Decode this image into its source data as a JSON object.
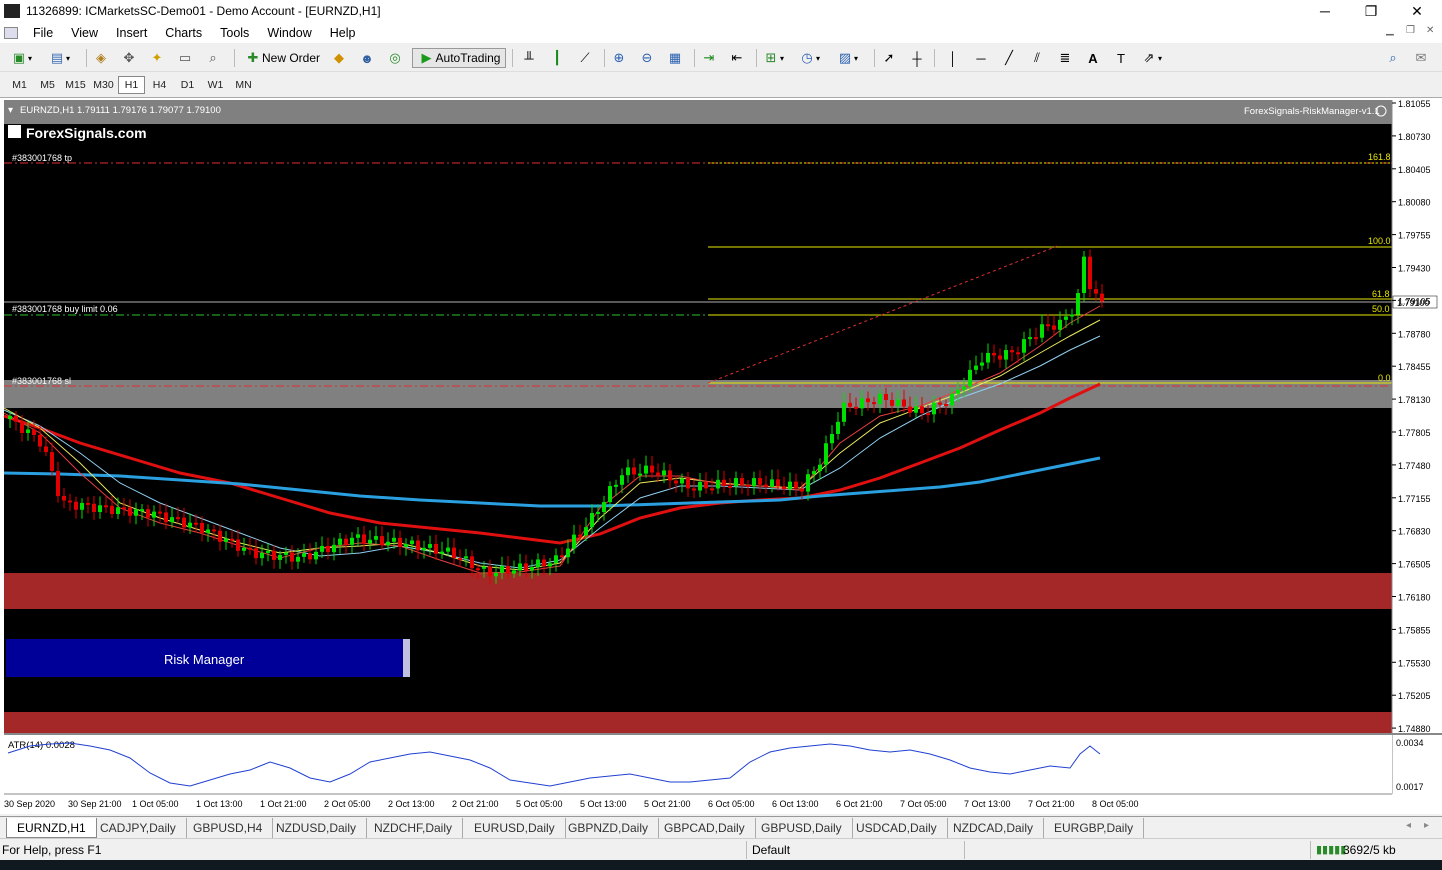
{
  "window": {
    "title": "11326899: ICMarketsSC-Demo01 - Demo Account - [EURNZD,H1]",
    "minimize": "─",
    "maximize": "❐",
    "close": "✕"
  },
  "menu": [
    "File",
    "View",
    "Insert",
    "Charts",
    "Tools",
    "Window",
    "Help"
  ],
  "toolbar": {
    "new_order": "New Order",
    "autotrading": "AutoTrading"
  },
  "timeframes": [
    "M1",
    "M5",
    "M15",
    "M30",
    "H1",
    "H4",
    "D1",
    "W1",
    "MN"
  ],
  "active_timeframe": "H1",
  "chart": {
    "header": "EURNZD,H1  1.79111 1.79176 1.79077 1.79100",
    "indicator_name": "ForexSignals-RiskManager-v1.1",
    "logo": "ForexSignals.com",
    "bg_color": "#000000",
    "current_price": "1.79100",
    "price_labels": [
      "1.81055",
      "1.80730",
      "1.80405",
      "1.80080",
      "1.79755",
      "1.79430",
      "1.79105",
      "1.78780",
      "1.78455",
      "1.78130",
      "1.77805",
      "1.77480",
      "1.77155",
      "1.76830",
      "1.76505",
      "1.76180",
      "1.75855",
      "1.75530",
      "1.75205",
      "1.74880"
    ],
    "time_labels": [
      "30 Sep 2020",
      "30 Sep 21:00",
      "1 Oct 05:00",
      "1 Oct 13:00",
      "1 Oct 21:00",
      "2 Oct 05:00",
      "2 Oct 13:00",
      "2 Oct 21:00",
      "5 Oct 05:00",
      "5 Oct 13:00",
      "5 Oct 21:00",
      "6 Oct 05:00",
      "6 Oct 13:00",
      "6 Oct 21:00",
      "7 Oct 05:00",
      "7 Oct 13:00",
      "7 Oct 21:00",
      "8 Oct 05:00"
    ],
    "order_lines": {
      "tp": "#383001768 tp",
      "buy_limit": "#383001768 buy limit 0.06",
      "sl": "#383001768 sl"
    },
    "fib_levels": [
      "161.8",
      "100.0",
      "61.8",
      "50.0",
      "0.0"
    ],
    "risk_manager_button": "Risk Manager",
    "atr_label": "ATR(14) 0.0028",
    "atr_scale": [
      "0.0034",
      "0.0017"
    ],
    "colors": {
      "bull": "#00e000",
      "bear": "#e00000",
      "ma_red": "#e01010",
      "ma_blue": "#2aa0e0",
      "zone_red": "#a52828",
      "zone_grey": "#808080",
      "fib": "#e8e800",
      "button": "#000099"
    }
  },
  "tabs": [
    "EURNZD,H1",
    "CADJPY,Daily",
    "GBPUSD,H4",
    "NZDUSD,Daily",
    "NZDCHF,Daily",
    "EURUSD,Daily",
    "GBPNZD,Daily",
    "GBPCAD,Daily",
    "GBPUSD,Daily",
    "USDCAD,Daily",
    "NZDCAD,Daily",
    "EURGBP,Daily"
  ],
  "status": {
    "help": "For Help, press F1",
    "profile": "Default",
    "traffic": "3692/5 kb"
  }
}
